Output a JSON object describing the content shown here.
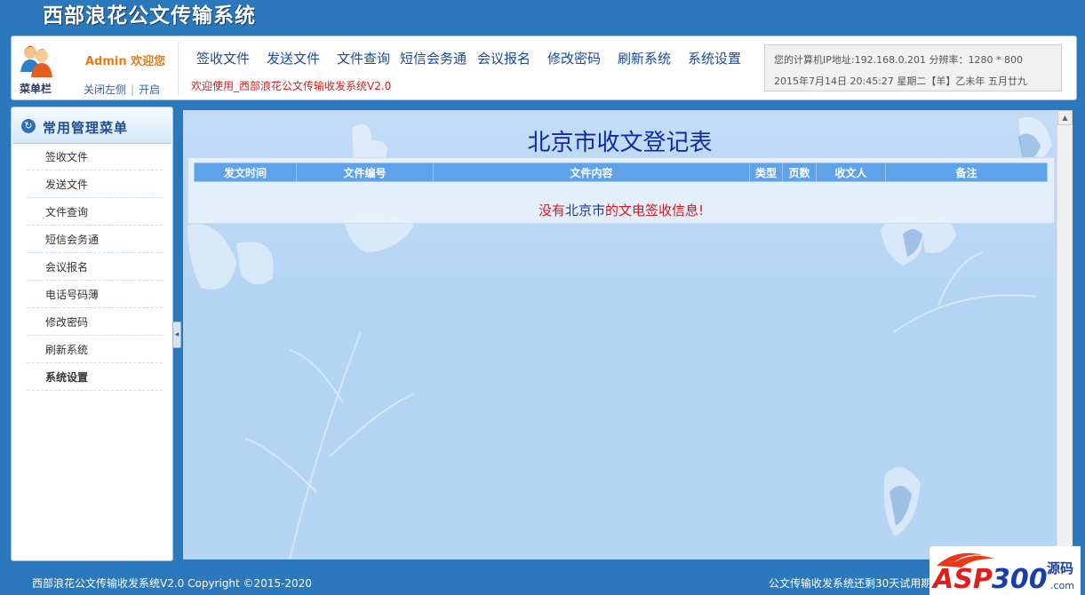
{
  "app": {
    "title": "西部浪花公文传输系统"
  },
  "header": {
    "admin_welcome": "Admin 欢迎您",
    "menu_bar_label": "菜单栏",
    "toggle": {
      "close": "关闭左侧",
      "separator": "|",
      "open": "开启"
    },
    "nav": [
      "签收文件",
      "发送文件",
      "文件查询",
      "短信会务通",
      "会议报名",
      "修改密码",
      "刷新系统",
      "系统设置"
    ],
    "welcome_line": "欢迎使用_西部浪花公文传输收发系统V2.0",
    "sysinfo": {
      "line1": "您的计算机IP地址:192.168.0.201   分辨率：1280 * 800",
      "line2": "2015年7月14日 20:45:27 星期二【羊】乙未年 五月廿九"
    }
  },
  "sidebar": {
    "title": "常用管理菜单",
    "items": [
      "签收文件",
      "发送文件",
      "文件查询",
      "短信会务通",
      "会议报名",
      "电话号码薄",
      "修改密码",
      "刷新系统",
      "系统设置"
    ]
  },
  "main": {
    "page_title": "北京市收文登记表",
    "columns": [
      "发文时间",
      "文件编号",
      "文件内容",
      "类型",
      "页数",
      "收文人",
      "备注"
    ],
    "empty_message": {
      "part1": "没有",
      "part2": "北京市",
      "part3": "的文电签收信息!"
    }
  },
  "footer": {
    "left": "西部浪花公文传输收发系统V2.0  Copyright ©2015-2020",
    "right": "公文传输收发系统还剩30天试用期"
  },
  "watermark": {
    "brand": "ASP300",
    "suffix": "源码",
    "domain": ".com"
  },
  "colors": {
    "background": "#2b78bd",
    "nav_text": "#1a4ba0",
    "header_th": "#5fa2e8",
    "title_blue": "#0d2ba6",
    "alert_red": "#d41a1a",
    "admin_orange": "#e77a18"
  }
}
